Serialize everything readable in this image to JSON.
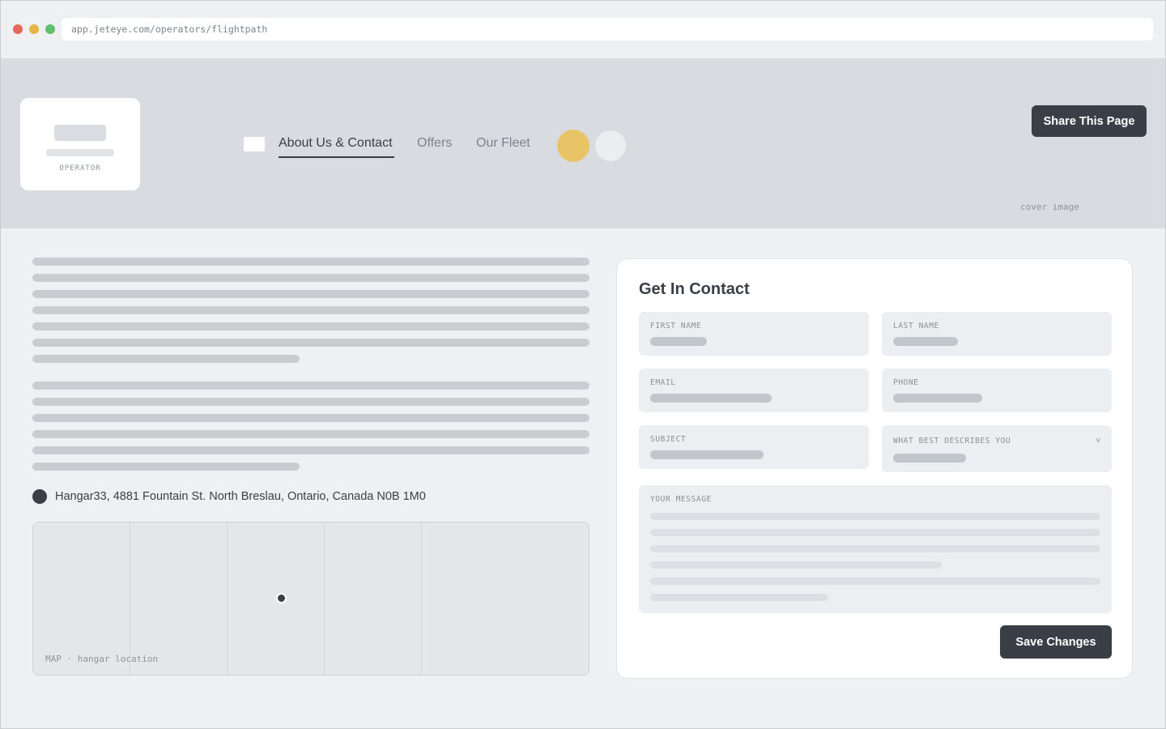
{
  "browser": {
    "url": "app.jeteye.com/operators/flightpath"
  },
  "header": {
    "logo_caption": "OPERATOR",
    "tabs": [
      {
        "label": "About Us & Contact",
        "active": true
      },
      {
        "label": "Offers",
        "active": false
      },
      {
        "label": "Our Fleet",
        "active": false
      }
    ],
    "share_label": "Share This Page",
    "cover_label": "cover image",
    "accent_color": "#e8c466"
  },
  "about": {
    "address": "Hangar33, 4881 Fountain St. North Breslau, Ontario, Canada N0B 1M0",
    "map_label": "MAP · hangar location"
  },
  "contact_form": {
    "title": "Get In Contact",
    "fields": {
      "first_name": "FIRST NAME",
      "last_name": "LAST NAME",
      "email": "EMAIL",
      "phone": "PHONE",
      "subject": "SUBJECT",
      "describes": "WHAT BEST DESCRIBES YOU",
      "message": "YOUR MESSAGE"
    },
    "dropdown_icon": "chevron-down-icon",
    "save_label": "Save Changes"
  },
  "colors": {
    "primary_dark": "#3a3f47",
    "page_bg": "#eef0f2",
    "cover_bg": "#d8dce0"
  }
}
